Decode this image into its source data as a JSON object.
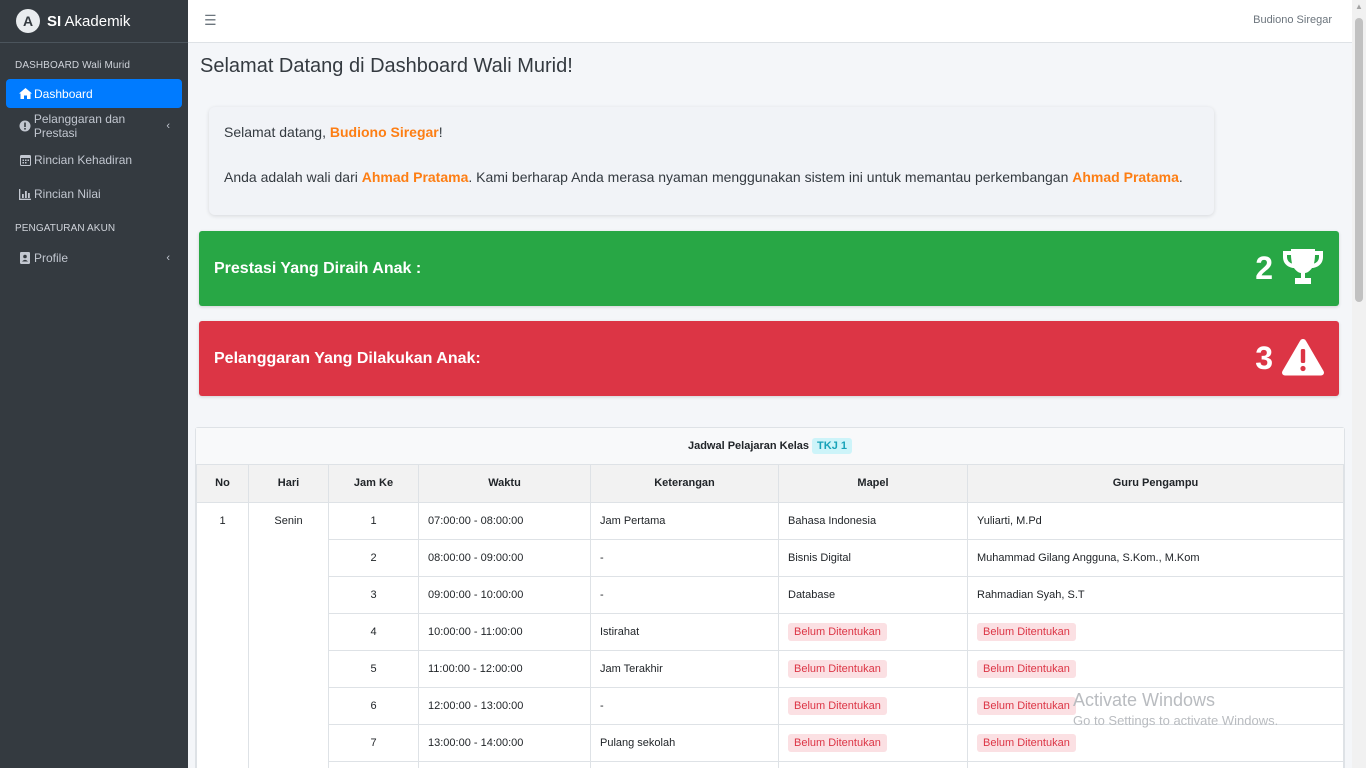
{
  "brand": {
    "logo_letter": "A",
    "bold": "SI",
    "rest": "Akademik"
  },
  "sidebar": {
    "header1": "DASHBOARD Wali Murid",
    "header2": "PENGATURAN AKUN",
    "items": [
      {
        "label": "Dashboard",
        "icon": "home-icon"
      },
      {
        "label": "Pelanggaran dan Prestasi",
        "icon": "exclamation-circle-icon"
      },
      {
        "label": "Rincian Kehadiran",
        "icon": "calendar-icon"
      },
      {
        "label": "Rincian Nilai",
        "icon": "bar-chart-icon"
      },
      {
        "label": "Profile",
        "icon": "id-badge-icon"
      }
    ]
  },
  "topbar": {
    "user_name": "Budiono Siregar"
  },
  "page": {
    "title": "Selamat Datang di Dashboard Wali Murid!"
  },
  "welcome": {
    "greet_prefix": "Selamat datang, ",
    "parent_name": "Budiono Siregar",
    "greet_suffix": "!",
    "line2_prefix": "Anda adalah wali dari ",
    "child_name": "Ahmad Pratama",
    "line2_middle": ". Kami berharap Anda merasa nyaman menggunakan sistem ini untuk memantau perkembangan ",
    "line2_suffix": "."
  },
  "prestasi": {
    "label": "Prestasi Yang Diraih Anak :",
    "count": "2",
    "color": "#28a745",
    "icon": "trophy-icon"
  },
  "pelanggaran": {
    "label": "Pelanggaran Yang Dilakukan Anak:",
    "count": "3",
    "color": "#dc3545",
    "icon": "warning-icon"
  },
  "schedule": {
    "caption": "Jadwal Pelajaran Kelas",
    "kelas": "TKJ 1",
    "headers": [
      "No",
      "Hari",
      "Jam Ke",
      "Waktu",
      "Keterangan",
      "Mapel",
      "Guru Pengampu"
    ],
    "no": "1",
    "hari": "Senin",
    "rows": [
      {
        "jam": "1",
        "waktu": "07:00:00 - 08:00:00",
        "ket": "Jam Pertama",
        "mapel": "Bahasa Indonesia",
        "guru": "Yuliarti, M.Pd"
      },
      {
        "jam": "2",
        "waktu": "08:00:00 - 09:00:00",
        "ket": "-",
        "mapel": "Bisnis Digital",
        "guru": "Muhammad Gilang Angguna, S.Kom., M.Kom"
      },
      {
        "jam": "3",
        "waktu": "09:00:00 - 10:00:00",
        "ket": "-",
        "mapel": "Database",
        "guru": "Rahmadian Syah, S.T"
      },
      {
        "jam": "4",
        "waktu": "10:00:00 - 11:00:00",
        "ket": "Istirahat",
        "mapel": "Belum Ditentukan",
        "guru": "Belum Ditentukan"
      },
      {
        "jam": "5",
        "waktu": "11:00:00 - 12:00:00",
        "ket": "Jam Terakhir",
        "mapel": "Belum Ditentukan",
        "guru": "Belum Ditentukan"
      },
      {
        "jam": "6",
        "waktu": "12:00:00 - 13:00:00",
        "ket": "-",
        "mapel": "Belum Ditentukan",
        "guru": "Belum Ditentukan"
      },
      {
        "jam": "7",
        "waktu": "13:00:00 - 14:00:00",
        "ket": "Pulang sekolah",
        "mapel": "Belum Ditentukan",
        "guru": "Belum Ditentukan"
      }
    ]
  },
  "watermark": {
    "line1": "Activate Windows",
    "line2": "Go to Settings to activate Windows."
  }
}
